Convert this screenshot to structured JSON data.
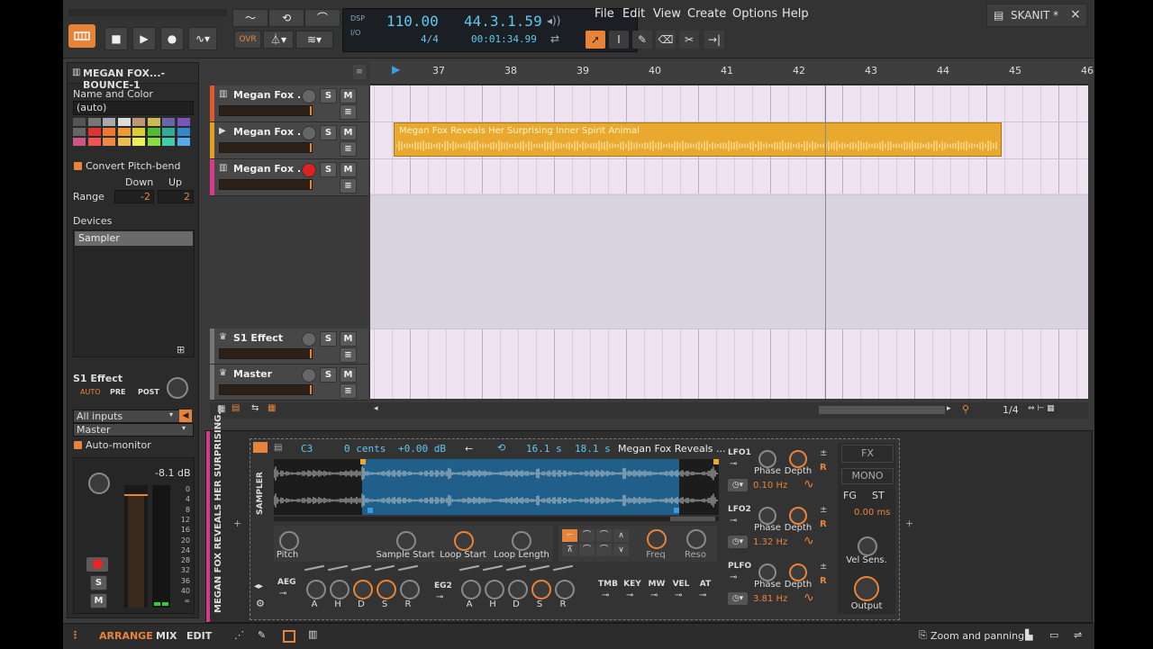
{
  "transport": {
    "tempo": "110.00",
    "position": "44.3.1.59",
    "time_signature": "4/4",
    "time": "00:01:34.99",
    "dsp_label": "DSP",
    "io_label": "I/O",
    "ovr_label": "OVR"
  },
  "menu": [
    "File",
    "Edit",
    "View",
    "Create",
    "Options",
    "Help"
  ],
  "project_tab": {
    "title": "SKANIT *",
    "close": "×"
  },
  "inspector": {
    "title": "MEGAN FOX...-BOUNCE-1",
    "name_color_label": "Name and Color",
    "name_value": "(auto)",
    "convert_pitchbend": "Convert Pitch-bend",
    "down_label": "Down",
    "up_label": "Up",
    "range_label": "Range",
    "range_down": "-2",
    "range_up": "2",
    "devices_label": "Devices",
    "device_item": "Sampler",
    "effect_label": "S1 Effect",
    "auto": "AUTO",
    "pre": "PRE",
    "post": "POST",
    "input": "All inputs",
    "output": "Master",
    "auto_monitor": "Auto-monitor",
    "db": "-8.1 dB",
    "meter_scale": [
      "0",
      "4",
      "8",
      "12",
      "16",
      "20",
      "24",
      "28",
      "32",
      "36",
      "40",
      "∞"
    ],
    "s": "S",
    "m": "M"
  },
  "tracks": [
    {
      "name": "Megan Fox ...",
      "color": "#e05a2a"
    },
    {
      "name": "Megan Fox ...",
      "color": "#e0a020"
    },
    {
      "name": "Megan Fox ...",
      "color": "#d63a8a"
    },
    {
      "name": "S1 Effect",
      "color": "#777777"
    },
    {
      "name": "Master",
      "color": "#777777"
    }
  ],
  "buttons": {
    "s": "S",
    "m": "M"
  },
  "ruler": [
    "37",
    "38",
    "39",
    "40",
    "41",
    "42",
    "43",
    "44",
    "45",
    "46"
  ],
  "clip": {
    "title": "Megan Fox Reveals Her Surprising Inner Spirit Animal"
  },
  "arrange_footer": {
    "zoom": "1/4"
  },
  "sampler": {
    "vertical_title": "MEGAN FOX REVEALS HER SURPRISING...",
    "device_name": "SAMPLER",
    "root_key": "C3",
    "cents": "0 cents",
    "gain": "+0.00 dB",
    "arrow": "←",
    "length1": "16.1 s",
    "length2": "18.1 s",
    "sample_name": "Megan Fox Reveals ...",
    "knobs": [
      "Pitch",
      "Sample Start",
      "Loop Start",
      "Loop Length",
      "Freq",
      "Reso"
    ],
    "aeg": "AEG",
    "eg2": "EG2",
    "env": [
      "A",
      "H",
      "D",
      "S",
      "R"
    ],
    "mods": [
      "TMB",
      "KEY",
      "MW",
      "VEL",
      "AT"
    ],
    "lfo1": {
      "label": "LFO1",
      "rate": "0.10 Hz"
    },
    "lfo2": {
      "label": "LFO2",
      "rate": "1.32 Hz"
    },
    "plfo": {
      "label": "PLFO",
      "rate": "3.81 Hz"
    },
    "phase": "Phase",
    "depth": "Depth",
    "r": "R",
    "pm": "±",
    "fx": "FX",
    "mono": "MONO",
    "fg": "FG",
    "st": "ST",
    "glide": "0.00 ms",
    "vel_sens": "Vel Sens.",
    "output": "Output"
  },
  "bottom": {
    "arrange": "ARRANGE",
    "mix": "MIX",
    "edit": "EDIT",
    "zoom_panning": "Zoom and panning"
  },
  "colors": {
    "accent": "#e8843a",
    "display": "#5ec8f0",
    "clip": "#e9a92e"
  }
}
